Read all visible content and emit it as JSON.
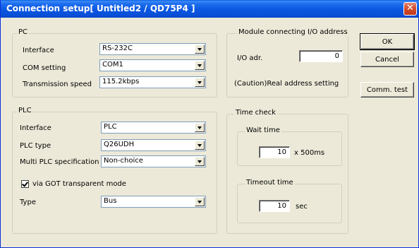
{
  "window": {
    "title": "Connection setup[ Untitled2 / QD75P4 ]",
    "close_glyph": "✕"
  },
  "pc": {
    "legend": "PC",
    "interface_label": "Interface",
    "interface_value": "RS-232C",
    "com_label": "COM setting",
    "com_value": "COM1",
    "speed_label": "Transmission speed",
    "speed_value": "115.2kbps"
  },
  "module": {
    "legend": "Module connecting I/O address",
    "io_label": "I/O adr.",
    "io_value": "0",
    "caution": "(Caution)Real address setting"
  },
  "buttons": {
    "ok": "OK",
    "cancel": "Cancel",
    "comm_test": "Comm. test"
  },
  "plc": {
    "legend": "PLC",
    "interface_label": "Interface",
    "interface_value": "PLC",
    "type_label": "PLC type",
    "type_value": "Q26UDH",
    "multi_label": "Multi PLC specification",
    "multi_value": "Non-choice",
    "got_label": "via GOT transparent mode",
    "got_checked": true,
    "conn_type_label": "Type",
    "conn_type_value": "Bus"
  },
  "time_check": {
    "legend": "Time check",
    "wait_legend": "Wait time",
    "wait_value": "10",
    "wait_unit": "x 500ms",
    "timeout_legend": "Timeout time",
    "timeout_value": "10",
    "timeout_unit": "sec"
  }
}
